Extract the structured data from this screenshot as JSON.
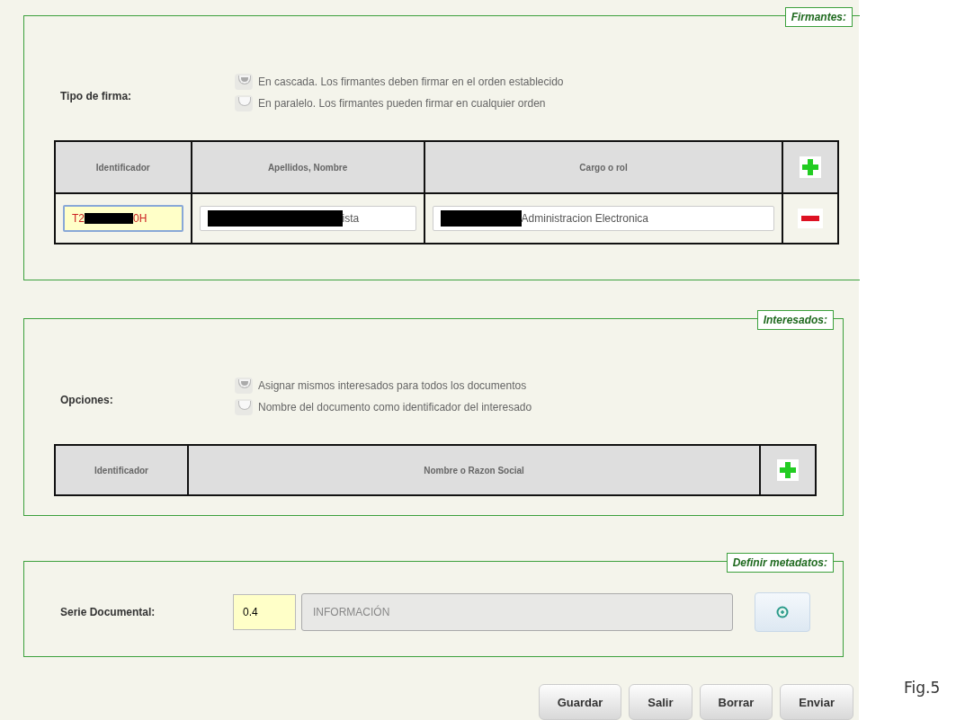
{
  "firmantes": {
    "legend": "Firmantes:",
    "label": "Tipo de firma:",
    "options": [
      {
        "label": "En cascada. Los firmantes deben firmar en el orden establecido",
        "selected": true
      },
      {
        "label": "En paralelo. Los firmantes pueden firmar en cualquier orden",
        "selected": false
      }
    ],
    "columns": [
      "Identificador",
      "Apellidos, Nombre",
      "Cargo o rol"
    ],
    "rows": [
      {
        "fields": [
          {
            "prefix": "T2",
            "suffix": "0H",
            "redacted": true,
            "highlighted": true
          },
          {
            "suffix": "ista",
            "redacted": true,
            "highlighted": false
          },
          {
            "suffix": "Administracion Electronica",
            "redacted": true,
            "highlighted": false
          }
        ]
      }
    ]
  },
  "interesados": {
    "legend": "Interesados:",
    "label": "Opciones:",
    "options": [
      {
        "label": "Asignar mismos interesados para todos los documentos",
        "selected": true
      },
      {
        "label": "Nombre del documento como identificador del interesado",
        "selected": false
      }
    ],
    "columns": [
      "Identificador",
      "Nombre o Razon Social"
    ]
  },
  "metadatos": {
    "legend": "Definir metadatos:",
    "label": "Serie Documental:",
    "code": "0.4",
    "name": "INFORMACIÓN"
  },
  "buttons": [
    "Guardar",
    "Salir",
    "Borrar",
    "Enviar"
  ],
  "caption": "Fig.5"
}
